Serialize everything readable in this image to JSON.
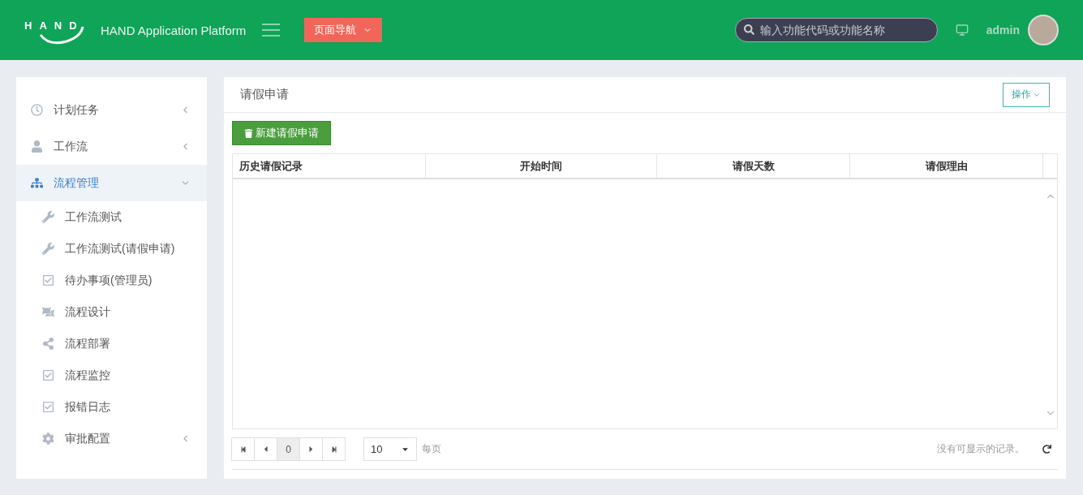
{
  "header": {
    "logo": "HAND",
    "title": "HAND Application Platform",
    "nav_button": "页面导航",
    "search": {
      "placeholder": "输入功能代码或功能名称"
    },
    "user": "admin"
  },
  "sidebar": {
    "items": [
      {
        "label": "计划任务",
        "expanded": false,
        "selected": false
      },
      {
        "label": "工作流",
        "expanded": false,
        "selected": false
      },
      {
        "label": "流程管理",
        "expanded": true,
        "selected": true,
        "children": [
          {
            "label": "工作流测试"
          },
          {
            "label": "工作流测试(请假申请)"
          },
          {
            "label": "待办事项(管理员)"
          },
          {
            "label": "流程设计"
          },
          {
            "label": "流程部署"
          },
          {
            "label": "流程监控"
          },
          {
            "label": "报错日志"
          },
          {
            "label": "审批配置",
            "expanded": false
          }
        ]
      }
    ]
  },
  "panel": {
    "title": "请假申请",
    "action_button": "操作",
    "new_button": "新建请假申请",
    "table": {
      "columns": [
        "历史请假记录",
        "开始时间",
        "请假天数",
        "请假理由"
      ]
    },
    "pager": {
      "page": "0",
      "page_size": "10",
      "per_page_label": "每页",
      "empty_message": "没有可显示的记录。"
    }
  }
}
